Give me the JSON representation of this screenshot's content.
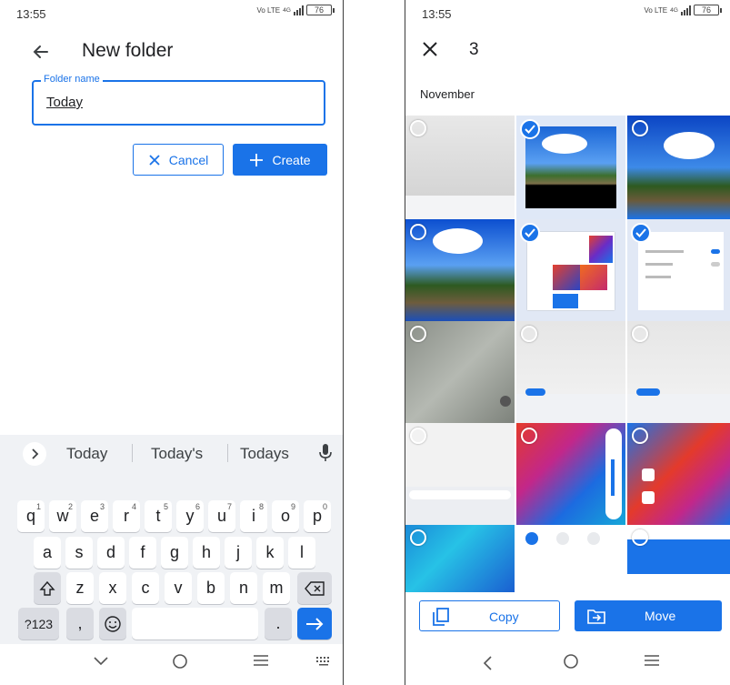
{
  "left": {
    "status": {
      "time": "13:55",
      "network": "Vo LTE",
      "network_sup": "4G",
      "battery": "76"
    },
    "title": "New folder",
    "field": {
      "label": "Folder name",
      "value": "Today"
    },
    "buttons": {
      "cancel": "Cancel",
      "create": "Create"
    },
    "keyboard": {
      "suggestions": [
        "Today",
        "Today's",
        "Todays"
      ],
      "row1": [
        {
          "key": "q",
          "sup": "1"
        },
        {
          "key": "w",
          "sup": "2"
        },
        {
          "key": "e",
          "sup": "3"
        },
        {
          "key": "r",
          "sup": "4"
        },
        {
          "key": "t",
          "sup": "5"
        },
        {
          "key": "y",
          "sup": "6"
        },
        {
          "key": "u",
          "sup": "7"
        },
        {
          "key": "i",
          "sup": "8"
        },
        {
          "key": "o",
          "sup": "9"
        },
        {
          "key": "p",
          "sup": "0"
        }
      ],
      "row2": [
        "a",
        "s",
        "d",
        "f",
        "g",
        "h",
        "j",
        "k",
        "l"
      ],
      "row3": [
        "z",
        "x",
        "c",
        "v",
        "b",
        "n",
        "m"
      ],
      "symbols_key": "?123",
      "comma_key": ",",
      "period_key": "."
    }
  },
  "right": {
    "status": {
      "time": "13:55",
      "network": "Vo LTE",
      "network_sup": "4G",
      "battery": "76"
    },
    "selected_count": "3",
    "section": "November",
    "buttons": {
      "copy": "Copy",
      "move": "Move"
    }
  },
  "colors": {
    "accent": "#1a73e8"
  }
}
